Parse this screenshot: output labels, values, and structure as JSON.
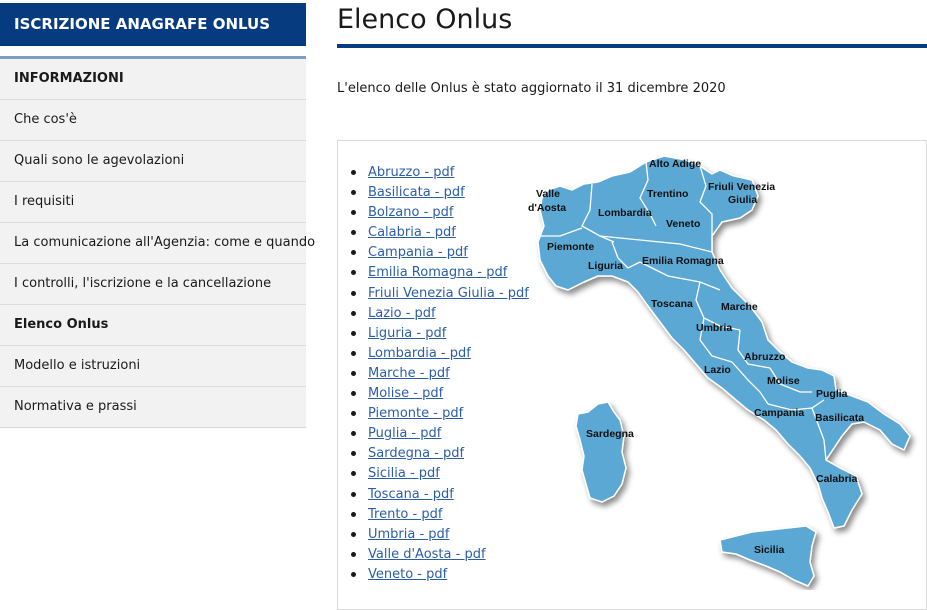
{
  "sidebar": {
    "header": "ISCRIZIONE ANAGRAFE ONLUS",
    "nav_title": "INFORMAZIONI",
    "items": [
      {
        "label": "Che cos'è"
      },
      {
        "label": "Quali sono le agevolazioni"
      },
      {
        "label": "I requisiti"
      },
      {
        "label": "La comunicazione all'Agenzia: come e quando"
      },
      {
        "label": "I controlli, l'iscrizione e la cancellazione"
      },
      {
        "label": "Elenco Onlus",
        "active": true
      },
      {
        "label": "Modello e istruzioni"
      },
      {
        "label": "Normativa e prassi"
      }
    ]
  },
  "main": {
    "title": "Elenco Onlus",
    "update_text": "L'elenco delle Onlus è stato aggiornato il 31 dicembre 2020",
    "regions": [
      "Abruzzo - pdf",
      "Basilicata - pdf",
      "Bolzano - pdf",
      "Calabria - pdf",
      "Campania - pdf",
      "Emilia Romagna - pdf",
      "Friuli Venezia Giulia - pdf",
      "Lazio - pdf",
      "Liguria - pdf",
      "Lombardia - pdf",
      "Marche - pdf",
      "Molise - pdf",
      "Piemonte - pdf",
      "Puglia - pdf",
      "Sardegna - pdf",
      "Sicilia - pdf",
      "Toscana - pdf",
      "Trento - pdf",
      "Umbria - pdf",
      "Valle d'Aosta - pdf",
      "Veneto - pdf"
    ]
  },
  "map": {
    "fill_color": "#5ba8d4",
    "labels": {
      "alto_adige": "Alto Adige",
      "valle_1": "Valle",
      "valle_2": "d'Aosta",
      "trentino": "Trentino",
      "friuli_1": "Friuli Venezia",
      "friuli_2": "Giulia",
      "lombardia": "Lombardia",
      "veneto": "Veneto",
      "piemonte": "Piemonte",
      "liguria": "Liguria",
      "emilia": "Emilia Romagna",
      "toscana": "Toscana",
      "marche": "Marche",
      "umbria": "Umbria",
      "abruzzo": "Abruzzo",
      "lazio": "Lazio",
      "molise": "Molise",
      "puglia": "Puglia",
      "campania": "Campania",
      "basilicata": "Basilicata",
      "sardegna": "Sardegna",
      "calabria": "Calabria",
      "sicilia": "Sicilia"
    }
  },
  "colors": {
    "brand_blue": "#063b80",
    "link_blue": "#2b5ea8",
    "nav_bg": "#f2f2f2"
  }
}
